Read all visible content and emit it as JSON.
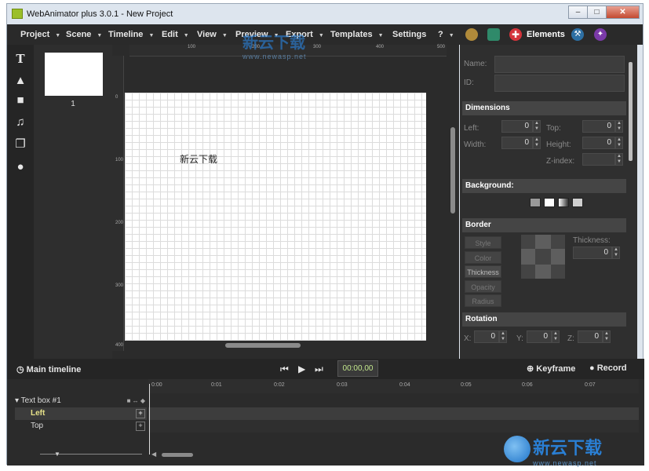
{
  "window": {
    "title": "WebAnimator plus 3.0.1 - New Project",
    "controls": [
      "minimize",
      "maximize",
      "close"
    ]
  },
  "menubar": {
    "items": [
      {
        "label": "Project",
        "has_arrow": true
      },
      {
        "label": "Scene",
        "has_arrow": true
      },
      {
        "label": "Timeline",
        "has_arrow": true
      },
      {
        "label": "Edit",
        "has_arrow": true
      },
      {
        "label": "View",
        "has_arrow": true
      },
      {
        "label": "Preview",
        "has_arrow": true
      },
      {
        "label": "Export",
        "has_arrow": true
      },
      {
        "label": "Templates",
        "has_arrow": true
      },
      {
        "label": "Settings",
        "has_arrow": false
      },
      {
        "label": "?",
        "has_arrow": true
      }
    ],
    "elements_label": "Elements"
  },
  "tools": [
    "text-tool-icon",
    "shape-tool-icon",
    "video-tool-icon",
    "audio-tool-icon",
    "layers-icon",
    "objects-icon"
  ],
  "scenes": [
    {
      "number": "1"
    }
  ],
  "stage": {
    "canvas_text": "新云下载",
    "h_ruler": [
      "100",
      "200",
      "300",
      "400",
      "500"
    ],
    "v_ruler": [
      "0",
      "100",
      "200",
      "300",
      "400"
    ]
  },
  "properties": {
    "name_label": "Name:",
    "id_label": "ID:",
    "dimensions": {
      "title": "Dimensions",
      "left_label": "Left:",
      "left_value": "0",
      "top_label": "Top:",
      "top_value": "0",
      "width_label": "Width:",
      "width_value": "0",
      "height_label": "Height:",
      "height_value": "0",
      "zindex_label": "Z-index:",
      "zindex_value": ""
    },
    "background": {
      "title": "Background:"
    },
    "border": {
      "title": "Border",
      "buttons": [
        "Style",
        "Color",
        "Thickness",
        "Opacity",
        "Radius"
      ],
      "thickness_label": "Thickness:",
      "thickness_value": "0"
    },
    "rotation": {
      "title": "Rotation",
      "x_label": "X:",
      "x_value": "0",
      "y_label": "Y:",
      "y_value": "0",
      "z_label": "Z:",
      "z_value": "0"
    }
  },
  "timeline": {
    "title": "Main timeline",
    "timecode": "00:00,00",
    "keyframe_label": "Keyframe",
    "record_label": "Record",
    "ticks": [
      "0:00",
      "0:01",
      "0:02",
      "0:03",
      "0:04",
      "0:05",
      "0:06",
      "0:07"
    ],
    "tracks": [
      {
        "label": "Text box #1",
        "type": "group"
      },
      {
        "label": "Left",
        "type": "property",
        "active": true
      },
      {
        "label": "Top",
        "type": "property",
        "active": false
      }
    ]
  },
  "watermark": {
    "text": "新云下载",
    "url": "www.newasp.net"
  }
}
